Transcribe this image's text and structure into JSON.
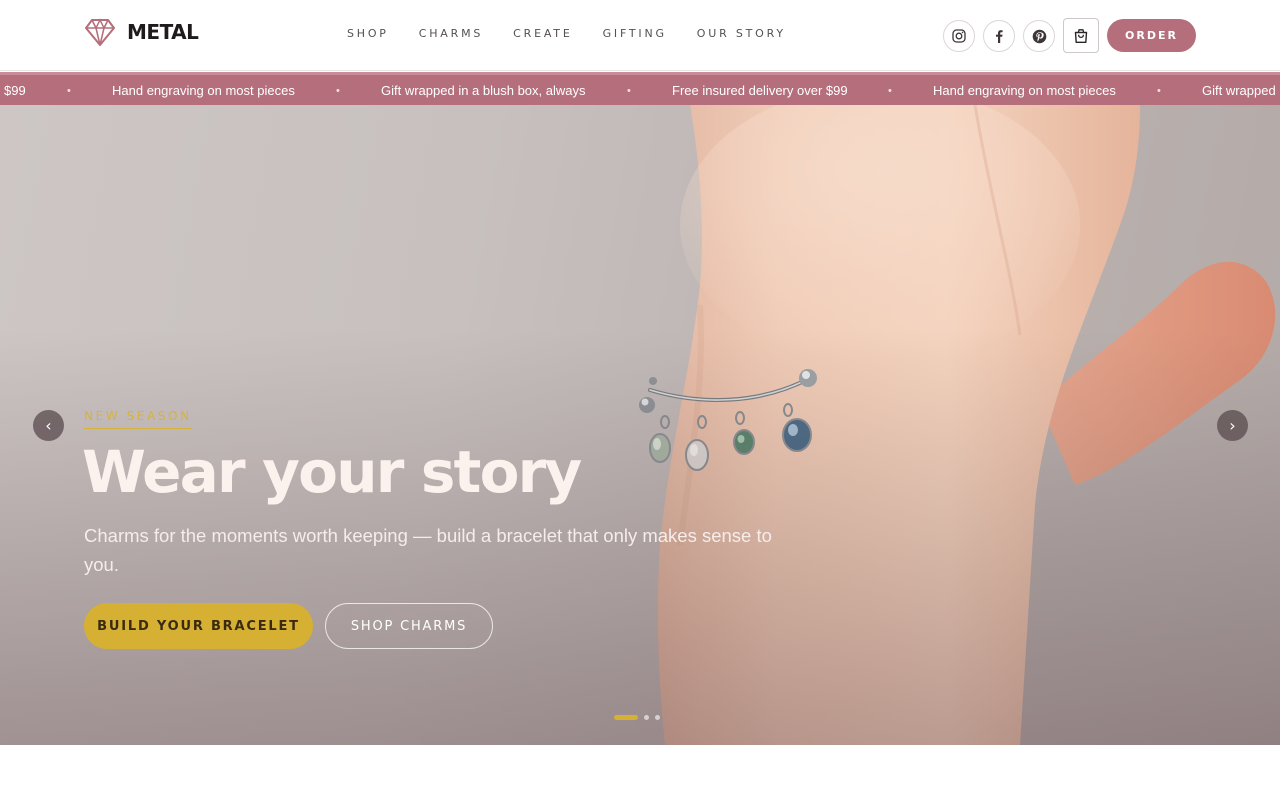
{
  "brand": {
    "name": "METAL",
    "accent": "#b56e7b",
    "gold": "#d5b032"
  },
  "nav": {
    "items": [
      {
        "label": "SHOP"
      },
      {
        "label": "CHARMS"
      },
      {
        "label": "CREATE"
      },
      {
        "label": "GIFTING"
      },
      {
        "label": "OUR STORY"
      }
    ]
  },
  "header": {
    "social_icons": [
      "instagram-icon",
      "facebook-icon",
      "pinterest-icon"
    ],
    "cart_icon": "shopping-bag-icon",
    "order_label": "ORDER"
  },
  "ticker": {
    "items": [
      "$99",
      "Hand engraving on most pieces",
      "Gift wrapped in a blush box, always",
      "Free insured delivery over $99",
      "Hand engraving on most pieces",
      "Gift wrapped"
    ],
    "separator": "•"
  },
  "hero": {
    "eyebrow": "NEW SEASON",
    "title": "Wear your story",
    "subtitle": "Charms for the moments worth keeping — build a bracelet that only makes sense to you.",
    "primary_cta": "BUILD YOUR BRACELET",
    "secondary_cta": "SHOP CHARMS",
    "prev_label": "‹",
    "next_label": "›",
    "slides_total": 3,
    "slide_active": 1
  }
}
